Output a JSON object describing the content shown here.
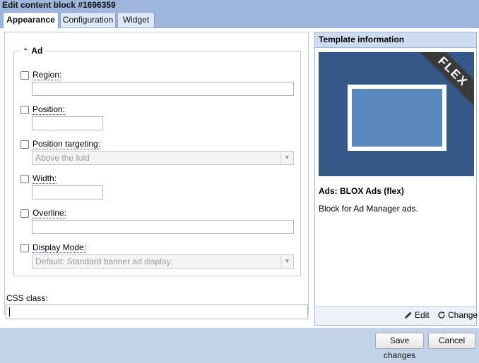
{
  "window": {
    "title": "Edit content block #1696359"
  },
  "tabs": [
    {
      "label": "Appearance",
      "active": true
    },
    {
      "label": "Configuration",
      "active": false
    },
    {
      "label": "Widget",
      "active": false
    }
  ],
  "ad_section": {
    "legend": "Ad",
    "fields": {
      "region": {
        "label": "Region:",
        "value": ""
      },
      "position": {
        "label": "Position:",
        "value": ""
      },
      "position_targeting": {
        "label": "Position targeting:",
        "selected": "Above the fold"
      },
      "width": {
        "label": "Width:",
        "value": ""
      },
      "overline": {
        "label": "Overline:",
        "value": ""
      },
      "display_mode": {
        "label": "Display Mode:",
        "selected": "Default: Standard banner ad display."
      }
    }
  },
  "css_class": {
    "label": "CSS class:",
    "value": ""
  },
  "template_info": {
    "header": "Template information",
    "thumbnail_badge": "FLEX",
    "name": "Ads: BLOX Ads (flex)",
    "description": "Block for Ad Manager ads.",
    "edit_label": "Edit",
    "change_label": "Change"
  },
  "footer": {
    "save_label": "Save changes",
    "cancel_label": "Cancel"
  },
  "colors": {
    "titlebar": "#9fb6dc",
    "thumbnail_bg": "#355888",
    "thumbnail_screen": "#5c88c0"
  }
}
